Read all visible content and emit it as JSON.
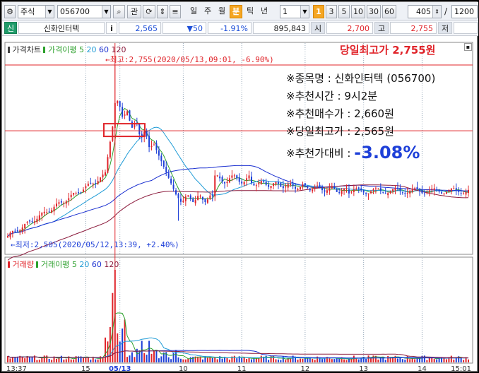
{
  "toolbar": {
    "market": "주식",
    "code": "056700",
    "btn_gwan": "관",
    "periods": [
      "일",
      "주",
      "월",
      "분",
      "틱",
      "년"
    ],
    "active_period": "분",
    "unit_value": "1",
    "minutes": [
      "1",
      "3",
      "5",
      "10",
      "30",
      "60"
    ],
    "active_minute": "1",
    "count": "405",
    "slash": "/",
    "total": "1200"
  },
  "quote": {
    "badge": "신",
    "name": "신화인터텍",
    "info_icon": "i",
    "price": "2,565",
    "change": "▼50",
    "rate": "-1.91%",
    "volume": "895,843",
    "open_label": "시",
    "open": "2,700",
    "high_label": "고",
    "high": "2,755",
    "low_label": "저"
  },
  "price_panel": {
    "title": "가격차트",
    "ma_label": "가격이평",
    "ma_periods": [
      "5",
      "20",
      "60",
      "120"
    ],
    "high_annot": "←최고:2,755(2020/05/13,09:01, -6.90%)",
    "low_annot": "←최저:2,505(2020/05/12,13:39, +2.40%)",
    "day_high_label": "당일최고가 2,755원"
  },
  "volume_panel": {
    "title": "거래량",
    "ma_label": "거래이평",
    "ma_periods": [
      "5",
      "20",
      "60",
      "120"
    ]
  },
  "info_box": {
    "line1": "※종목명 : 신화인터텍 (056700)",
    "line2": "※추천시간 : 9시2분",
    "line3": "※추천매수가 : 2,660원",
    "line4": "※당일최고가 : 2,565원",
    "line5_label": "※추천가대비 : ",
    "line5_value": "-3.08%"
  },
  "xaxis": {
    "ticks": [
      "13:37",
      "15",
      "05/13",
      "10",
      "11",
      "12",
      "13",
      "14",
      "15:01"
    ]
  },
  "colors": {
    "ma5": "#2ca02c",
    "ma20": "#1f9bd6",
    "ma60": "#1a2fd0",
    "ma120": "#8b1a3c",
    "up": "#e0242a",
    "down": "#1d3fd8",
    "active": "#f5a623"
  },
  "chart_data": {
    "type": "candlestick",
    "price_axis_range": [
      2505,
      2755
    ],
    "series_names": [
      "가격이평 5",
      "가격이평 20",
      "가격이평 60",
      "가격이평 120"
    ],
    "high": 2755,
    "low": 2505,
    "recommend_buy": 2660
  }
}
